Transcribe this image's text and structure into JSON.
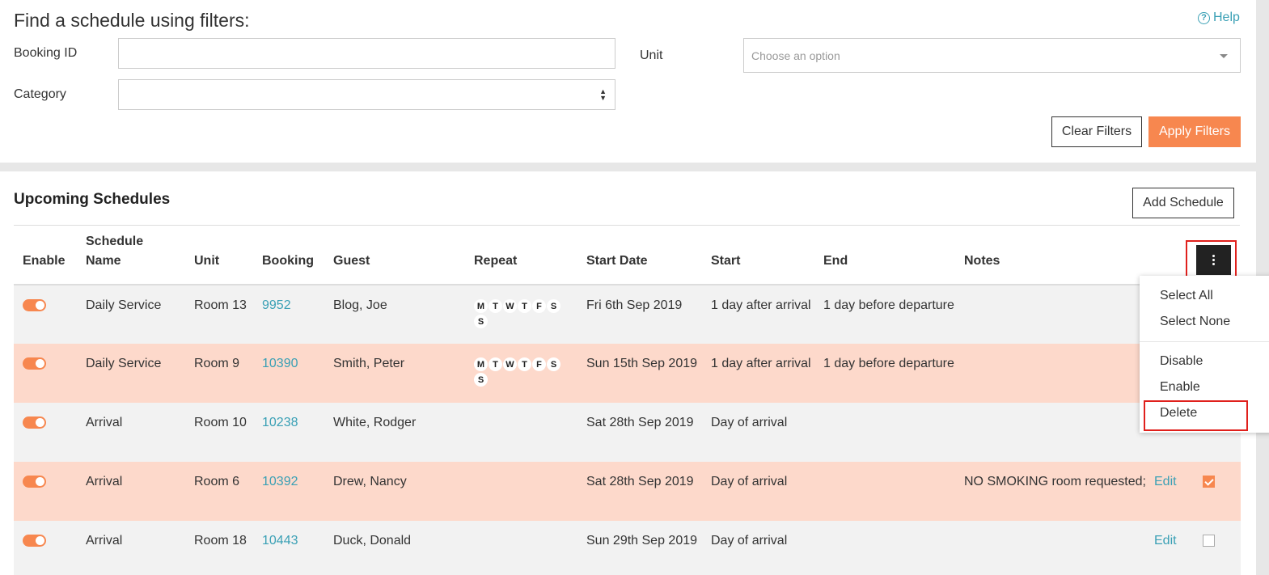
{
  "filters": {
    "title": "Find a schedule using filters:",
    "help": "Help",
    "booking_id_label": "Booking ID",
    "booking_id_value": "",
    "category_label": "Category",
    "category_value": "",
    "unit_label": "Unit",
    "unit_placeholder": "Choose an option",
    "clear_label": "Clear Filters",
    "apply_label": "Apply Filters"
  },
  "schedules": {
    "title": "Upcoming Schedules",
    "add_label": "Add Schedule",
    "headers": {
      "enable": "Enable",
      "name_line1": "Schedule",
      "name_line2": "Name",
      "unit": "Unit",
      "booking": "Booking",
      "guest": "Guest",
      "repeat": "Repeat",
      "start_date": "Start Date",
      "start": "Start",
      "end": "End",
      "notes": "Notes"
    },
    "day_letters": [
      "M",
      "T",
      "W",
      "T",
      "F",
      "S",
      "S"
    ],
    "rows": [
      {
        "name": "Daily Service",
        "unit": "Room 13",
        "booking": "9952",
        "guest": "Blog, Joe",
        "start_date": "Fri 6th Sep 2019",
        "start": "1 day after arrival",
        "end": "1 day before departure",
        "notes": "",
        "edit": "",
        "checked": false
      },
      {
        "name": "Daily Service",
        "unit": "Room 9",
        "booking": "10390",
        "guest": "Smith, Peter",
        "start_date": "Sun 15th Sep 2019",
        "start": "1 day after arrival",
        "end": "1 day before departure",
        "notes": "",
        "edit": "",
        "checked": false
      },
      {
        "name": "Arrival",
        "unit": "Room 10",
        "booking": "10238",
        "guest": "White, Rodger",
        "start_date": "Sat 28th Sep 2019",
        "start": "Day of arrival",
        "end": "",
        "notes": "",
        "edit": "",
        "checked": false
      },
      {
        "name": "Arrival",
        "unit": "Room 6",
        "booking": "10392",
        "guest": "Drew, Nancy",
        "start_date": "Sat 28th Sep 2019",
        "start": "Day of arrival",
        "end": "",
        "notes": "NO SMOKING room requested;",
        "edit": "Edit",
        "checked": true
      },
      {
        "name": "Arrival",
        "unit": "Room 18",
        "booking": "10443",
        "guest": "Duck, Donald",
        "start_date": "Sun 29th Sep 2019",
        "start": "Day of arrival",
        "end": "",
        "notes": "",
        "edit": "Edit",
        "checked": false
      }
    ]
  },
  "menu": {
    "select_all": "Select All",
    "select_none": "Select None",
    "disable": "Disable",
    "enable": "Enable",
    "delete": "Delete"
  },
  "colors": {
    "accent": "#f7874f",
    "link": "#3aa0b5",
    "highlight": "#e0201c",
    "row_alt": "#fdd9cb"
  }
}
